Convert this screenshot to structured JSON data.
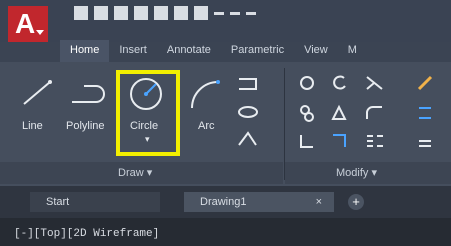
{
  "app": {
    "logo_letter": "A",
    "tabs": [
      "Home",
      "Insert",
      "Annotate",
      "Parametric",
      "View",
      "M"
    ],
    "ribbon": {
      "draw_tools": [
        "Line",
        "Polyline",
        "Circle",
        "Arc"
      ],
      "draw_panel_label": "Draw ▾",
      "modify_panel_label": "Modify ▾"
    },
    "documents": {
      "start_label": "Start",
      "drawing_label": "Drawing1",
      "close_glyph": "×",
      "new_tab_glyph": "+"
    },
    "command_line": "[-][Top][2D Wireframe]"
  },
  "colors": {
    "accent_red": "#c1272d",
    "highlight_yellow": "#f3ef00",
    "ribbon_bg": "#454e5d"
  }
}
